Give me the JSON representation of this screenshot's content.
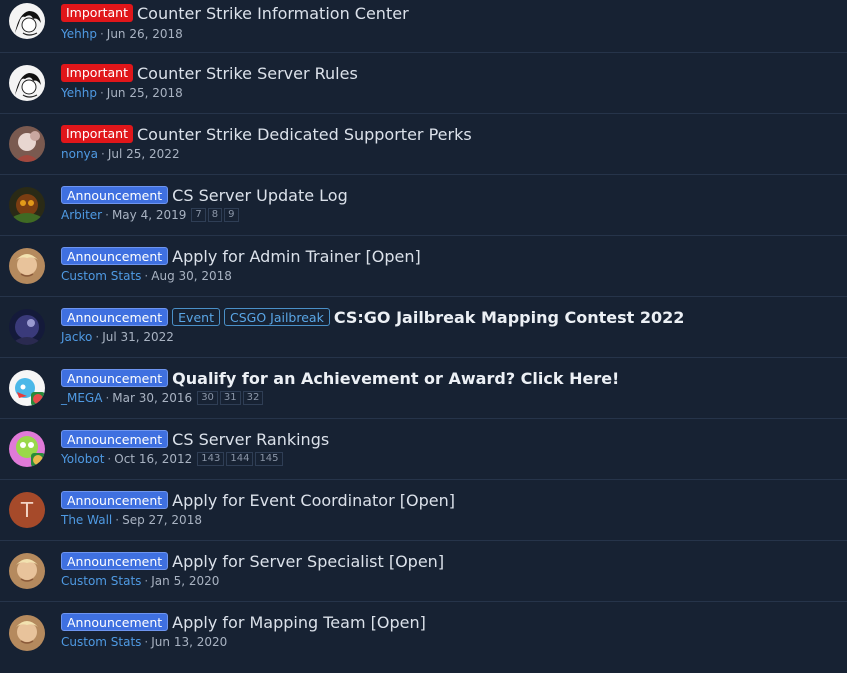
{
  "threads": [
    {
      "label": "Important",
      "title": "Counter Strike Information Center",
      "author": "Yehhp",
      "date": "Jun 26, 2018",
      "pages": []
    },
    {
      "label": "Important",
      "title": "Counter Strike Server Rules",
      "author": "Yehhp",
      "date": "Jun 25, 2018",
      "pages": []
    },
    {
      "label": "Important",
      "title": "Counter Strike Dedicated Supporter Perks",
      "author": "nonya",
      "date": "Jul 25, 2022",
      "pages": []
    },
    {
      "label": "Announcement",
      "title": "CS Server Update Log",
      "author": "Arbiter",
      "date": "May 4, 2019",
      "pages": [
        "7",
        "8",
        "9"
      ]
    },
    {
      "label": "Announcement",
      "title": "Apply for Admin Trainer [Open]",
      "author": "Custom Stats",
      "date": "Aug 30, 2018",
      "pages": []
    },
    {
      "label": "Announcement",
      "extra_labels": [
        "Event",
        "CSGO Jailbreak"
      ],
      "title": "CS:GO Jailbreak Mapping Contest 2022",
      "author": "Jacko",
      "date": "Jul 31, 2022",
      "pages": []
    },
    {
      "label": "Announcement",
      "title": "Qualify for an Achievement or Award? Click Here!",
      "author": "_MEGA",
      "date": "Mar 30, 2016",
      "pages": [
        "30",
        "31",
        "32"
      ]
    },
    {
      "label": "Announcement",
      "title": "CS Server Rankings",
      "author": "Yolobot",
      "date": "Oct 16, 2012",
      "pages": [
        "143",
        "144",
        "145"
      ]
    },
    {
      "label": "Announcement",
      "title": "Apply for Event Coordinator [Open]",
      "author": "The Wall",
      "date": "Sep 27, 2018",
      "pages": [],
      "avatar_letter": "T"
    },
    {
      "label": "Announcement",
      "title": "Apply for Server Specialist [Open]",
      "author": "Custom Stats",
      "date": "Jan 5, 2020",
      "pages": []
    },
    {
      "label": "Announcement",
      "title": "Apply for Mapping Team [Open]",
      "author": "Custom Stats",
      "date": "Jun 13, 2020",
      "pages": []
    }
  ],
  "meta_separator": "·",
  "colors": {
    "background": "#172233",
    "important": "#e0161a",
    "announcement": "#3f70e0",
    "author_link": "#4f9ae3",
    "letter_avatar": "#a64a2a"
  }
}
